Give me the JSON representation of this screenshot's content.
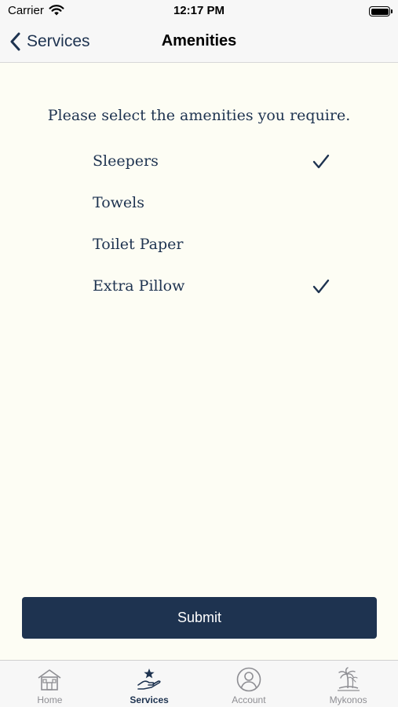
{
  "status_bar": {
    "carrier": "Carrier",
    "time": "12:17 PM"
  },
  "nav": {
    "back_label": "Services",
    "title": "Amenities"
  },
  "prompt": "Please select the amenities you require.",
  "amenities": [
    {
      "label": "Sleepers",
      "checked": true
    },
    {
      "label": "Towels",
      "checked": false
    },
    {
      "label": "Toilet Paper",
      "checked": false
    },
    {
      "label": "Extra Pillow",
      "checked": true
    }
  ],
  "submit_label": "Submit",
  "tabs": [
    {
      "label": "Home",
      "icon": "house-icon",
      "active": false
    },
    {
      "label": "Services",
      "icon": "hand-star-icon",
      "active": true
    },
    {
      "label": "Account",
      "icon": "person-circle-icon",
      "active": false
    },
    {
      "label": "Mykonos",
      "icon": "palm-island-icon",
      "active": false
    }
  ],
  "colors": {
    "accent": "#1e3350",
    "background": "#fdfdf4",
    "inactive_tab": "#8e8e93"
  }
}
